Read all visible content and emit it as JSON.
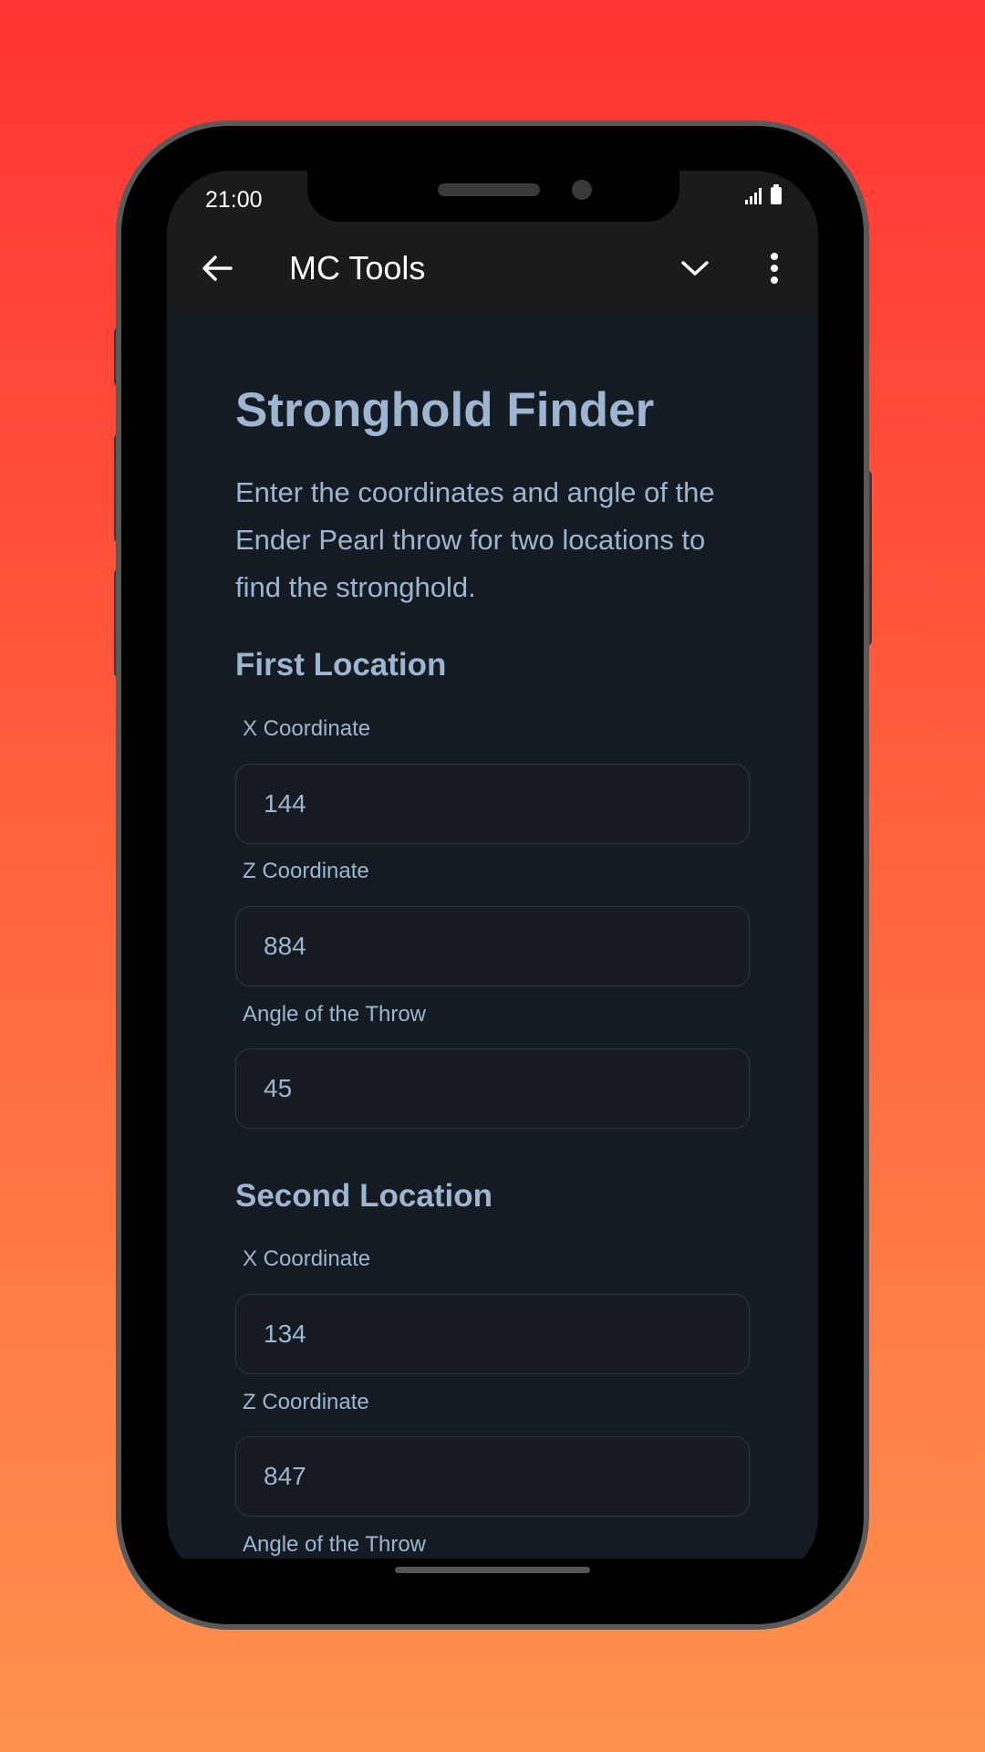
{
  "status_bar": {
    "time": "21:00"
  },
  "app_bar": {
    "title": "MC Tools",
    "back_icon": "arrow-left-icon",
    "dropdown_icon": "chevron-down-icon",
    "menu_icon": "more-vert-icon"
  },
  "page": {
    "title": "Stronghold Finder",
    "intro": "Enter the coordinates and angle of the Ender Pearl throw for two locations to find the stronghold."
  },
  "first_location": {
    "heading": "First Location",
    "x_label": "X Coordinate",
    "x_value": "144",
    "z_label": "Z Coordinate",
    "z_value": "884",
    "angle_label": "Angle of the Throw",
    "angle_value": "45"
  },
  "second_location": {
    "heading": "Second Location",
    "x_label": "X Coordinate",
    "x_value": "134",
    "z_label": "Z Coordinate",
    "z_value": "847",
    "angle_label": "Angle of the Throw"
  },
  "colors": {
    "background_top": "#ff3434",
    "background_bottom": "#ff9150",
    "screen_bg": "#141b22",
    "app_bar_bg": "#1b1b1b",
    "text_accent": "#9db5d0"
  }
}
